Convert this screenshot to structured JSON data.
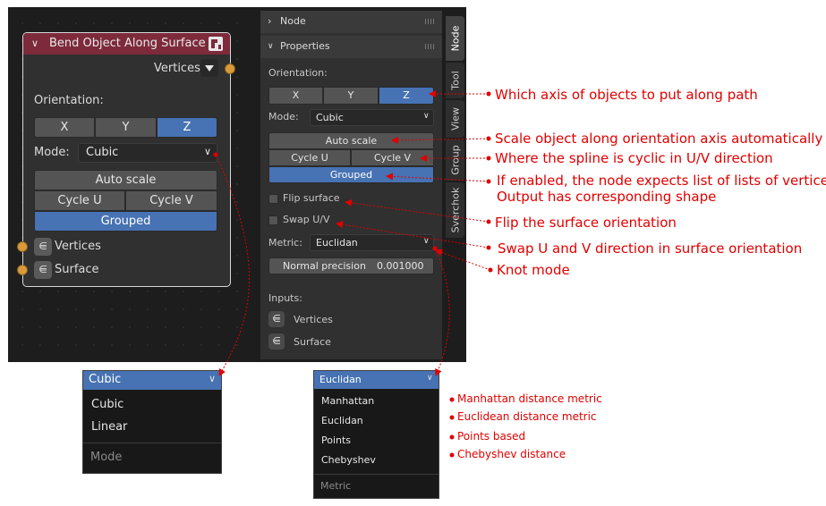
{
  "node": {
    "title": "Bend Object Along Surface",
    "output_socket": "Vertices",
    "orientation_label": "Orientation:",
    "axes": [
      "X",
      "Y",
      "Z"
    ],
    "active_axis": "Z",
    "mode_label": "Mode:",
    "mode_value": "Cubic",
    "auto_scale": "Auto scale",
    "cycle_u": "Cycle U",
    "cycle_v": "Cycle V",
    "grouped": "Grouped",
    "inputs": [
      "Vertices",
      "Surface"
    ]
  },
  "sidebar": {
    "node_header": "Node",
    "properties_header": "Properties",
    "orientation_label": "Orientation:",
    "axes": [
      "X",
      "Y",
      "Z"
    ],
    "mode_label": "Mode:",
    "mode_value": "Cubic",
    "auto_scale": "Auto scale",
    "cycle_u": "Cycle U",
    "cycle_v": "Cycle V",
    "grouped": "Grouped",
    "flip_surface": "Flip surface",
    "swap_uv": "Swap U/V",
    "metric_label": "Metric:",
    "metric_value": "Euclidan",
    "normal_precision_label": "Normal precision",
    "normal_precision_value": "0.001000",
    "inputs_label": "Inputs:",
    "inputs": [
      "Vertices",
      "Surface"
    ]
  },
  "tabs": [
    "Node",
    "Tool",
    "View",
    "Group",
    "Sverchok"
  ],
  "annotations": {
    "axis": "Which axis of objects to put along path",
    "auto_scale": "Scale object along orientation axis automatically",
    "cyclic": "Where the spline is cyclic in U/V direction",
    "grouped_1": "If enabled, the node expects list of lists of vertices",
    "grouped_2": "Output has corresponding shape",
    "flip": "Flip the surface orientation",
    "swap": "Swap U and V direction in surface orientation",
    "knot": "Knot mode"
  },
  "mode_menu": {
    "selected": "Cubic",
    "items": [
      "Cubic",
      "Linear"
    ],
    "footer": "Mode"
  },
  "metric_menu": {
    "selected": "Euclidan",
    "items": [
      "Manhattan",
      "Euclidan",
      "Points",
      "Chebyshev"
    ],
    "footer": "Metric",
    "notes": [
      "Manhattan distance metric",
      "Euclidean distance metric",
      "Points based",
      "Chebyshev distance"
    ]
  }
}
